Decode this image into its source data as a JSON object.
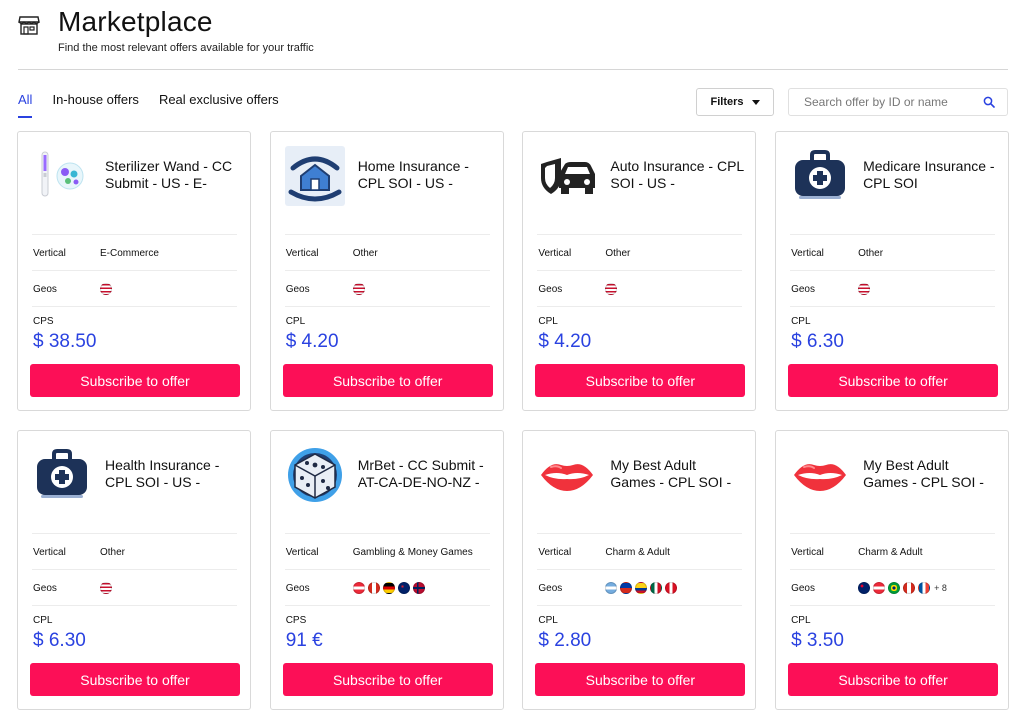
{
  "header": {
    "icon": "store-icon",
    "title": "Marketplace",
    "subtitle": "Find the most relevant offers available for your traffic"
  },
  "tabs": [
    {
      "label": "All",
      "active": true
    },
    {
      "label": "In-house offers",
      "active": false
    },
    {
      "label": "Real exclusive offers",
      "active": false
    }
  ],
  "filters": {
    "label": "Filters",
    "icon": "caret-down-icon"
  },
  "search": {
    "placeholder": "Search offer by ID or name",
    "value": "",
    "icon": "search-icon"
  },
  "labels": {
    "vertical": "Vertical",
    "geos": "Geos",
    "subscribe": "Subscribe to offer"
  },
  "colors": {
    "accent": "#2a42e0",
    "cta": "#fc0f57"
  },
  "offers": [
    {
      "title": "Sterilizer Wand - CC Submit - US - E-",
      "logo": "sterilizer-wand-icon",
      "vertical": "E-Commerce",
      "geos": [
        "us"
      ],
      "more": "",
      "payout_type": "CPS",
      "payout": "$ 38.50"
    },
    {
      "title": "Home Insurance - CPL SOI - US -",
      "logo": "home-insurance-icon",
      "vertical": "Other",
      "geos": [
        "us"
      ],
      "more": "",
      "payout_type": "CPL",
      "payout": "$ 4.20"
    },
    {
      "title": "Auto Insurance - CPL SOI - US -",
      "logo": "auto-insurance-icon",
      "vertical": "Other",
      "geos": [
        "us"
      ],
      "more": "",
      "payout_type": "CPL",
      "payout": "$ 4.20"
    },
    {
      "title": "Medicare Insurance - CPL SOI",
      "logo": "medical-kit-icon",
      "vertical": "Other",
      "geos": [
        "us"
      ],
      "more": "",
      "payout_type": "CPL",
      "payout": "$ 6.30"
    },
    {
      "title": "Health Insurance - CPL SOI - US -",
      "logo": "medical-kit-icon",
      "vertical": "Other",
      "geos": [
        "us"
      ],
      "more": "",
      "payout_type": "CPL",
      "payout": "$ 6.30"
    },
    {
      "title": "MrBet - CC Submit - AT-CA-DE-NO-NZ -",
      "logo": "dice-icon",
      "vertical": "Gambling & Money Games",
      "geos": [
        "at",
        "ca",
        "de",
        "nz",
        "no"
      ],
      "more": "",
      "payout_type": "CPS",
      "payout": "91 €"
    },
    {
      "title": "My Best Adult Games - CPL SOI -",
      "logo": "lips-icon",
      "vertical": "Charm & Adult",
      "geos": [
        "ar",
        "cl",
        "co",
        "mx",
        "pe"
      ],
      "more": "",
      "payout_type": "CPL",
      "payout": "$ 2.80"
    },
    {
      "title": "My Best Adult Games - CPL SOI -",
      "logo": "lips-icon",
      "vertical": "Charm & Adult",
      "geos": [
        "au",
        "at",
        "br",
        "ca",
        "fr"
      ],
      "more": "+ 8",
      "payout_type": "CPL",
      "payout": "$ 3.50"
    }
  ]
}
